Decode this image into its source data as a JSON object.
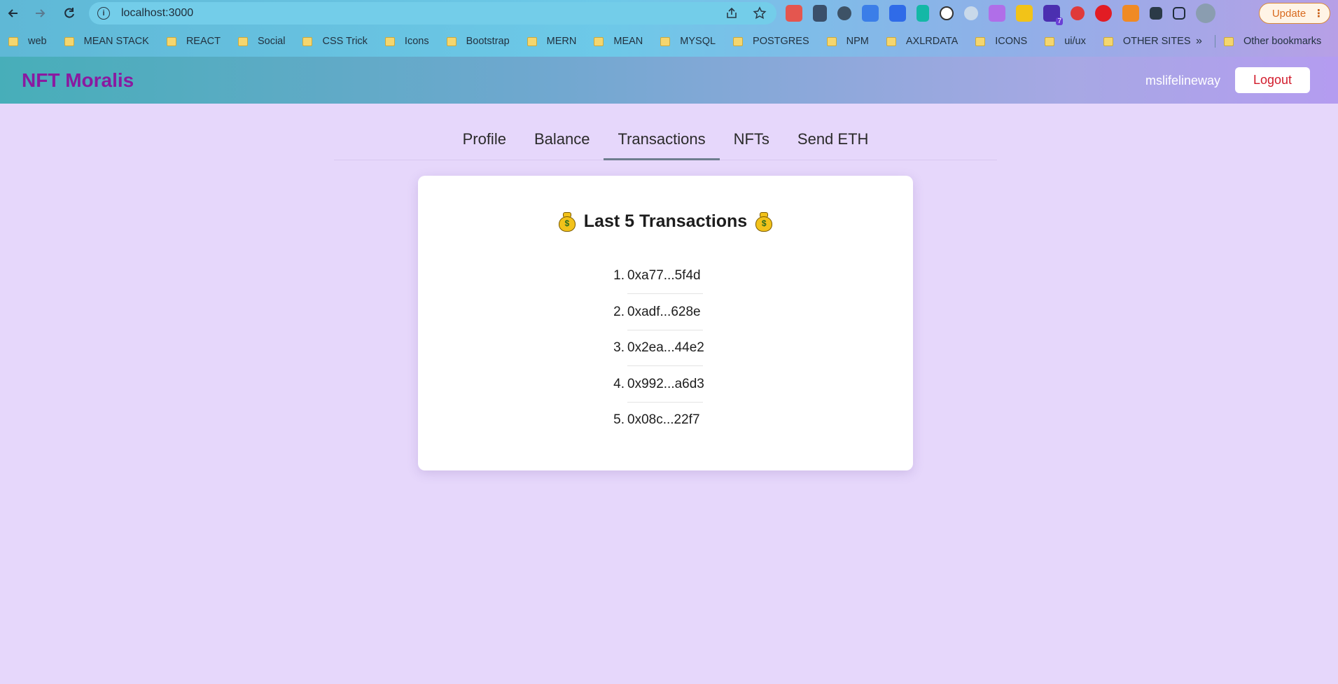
{
  "browser": {
    "url": "localhost:3000",
    "update_label": "Update",
    "bookmarks": [
      "web",
      "MEAN STACK",
      "REACT",
      "Social",
      "CSS Trick",
      "Icons",
      "Bootstrap",
      "MERN",
      "MEAN",
      "MYSQL",
      "POSTGRES",
      "NPM",
      "AXLRDATA",
      "ICONS",
      "ui/ux",
      "OTHER SITES"
    ],
    "more_label": "»",
    "other_bookmarks": "Other bookmarks",
    "extension_badge": "7"
  },
  "header": {
    "brand": "NFT Moralis",
    "username": "mslifelineway",
    "logout_label": "Logout"
  },
  "tabs": [
    {
      "label": "Profile",
      "active": false
    },
    {
      "label": "Balance",
      "active": false
    },
    {
      "label": "Transactions",
      "active": true
    },
    {
      "label": "NFTs",
      "active": false
    },
    {
      "label": "Send ETH",
      "active": false
    }
  ],
  "card": {
    "title": "Last 5 Transactions",
    "transactions": [
      {
        "num": "1.",
        "hash": "0xa77...5f4d"
      },
      {
        "num": "2.",
        "hash": "0xadf...628e"
      },
      {
        "num": "3.",
        "hash": "0x2ea...44e2"
      },
      {
        "num": "4.",
        "hash": "0x992...a6d3"
      },
      {
        "num": "5.",
        "hash": "0x08c...22f7"
      }
    ]
  },
  "colors": {
    "page_bg": "#e6d7fb",
    "brand": "#8a1aa0",
    "logout_text": "#d21b2b"
  }
}
